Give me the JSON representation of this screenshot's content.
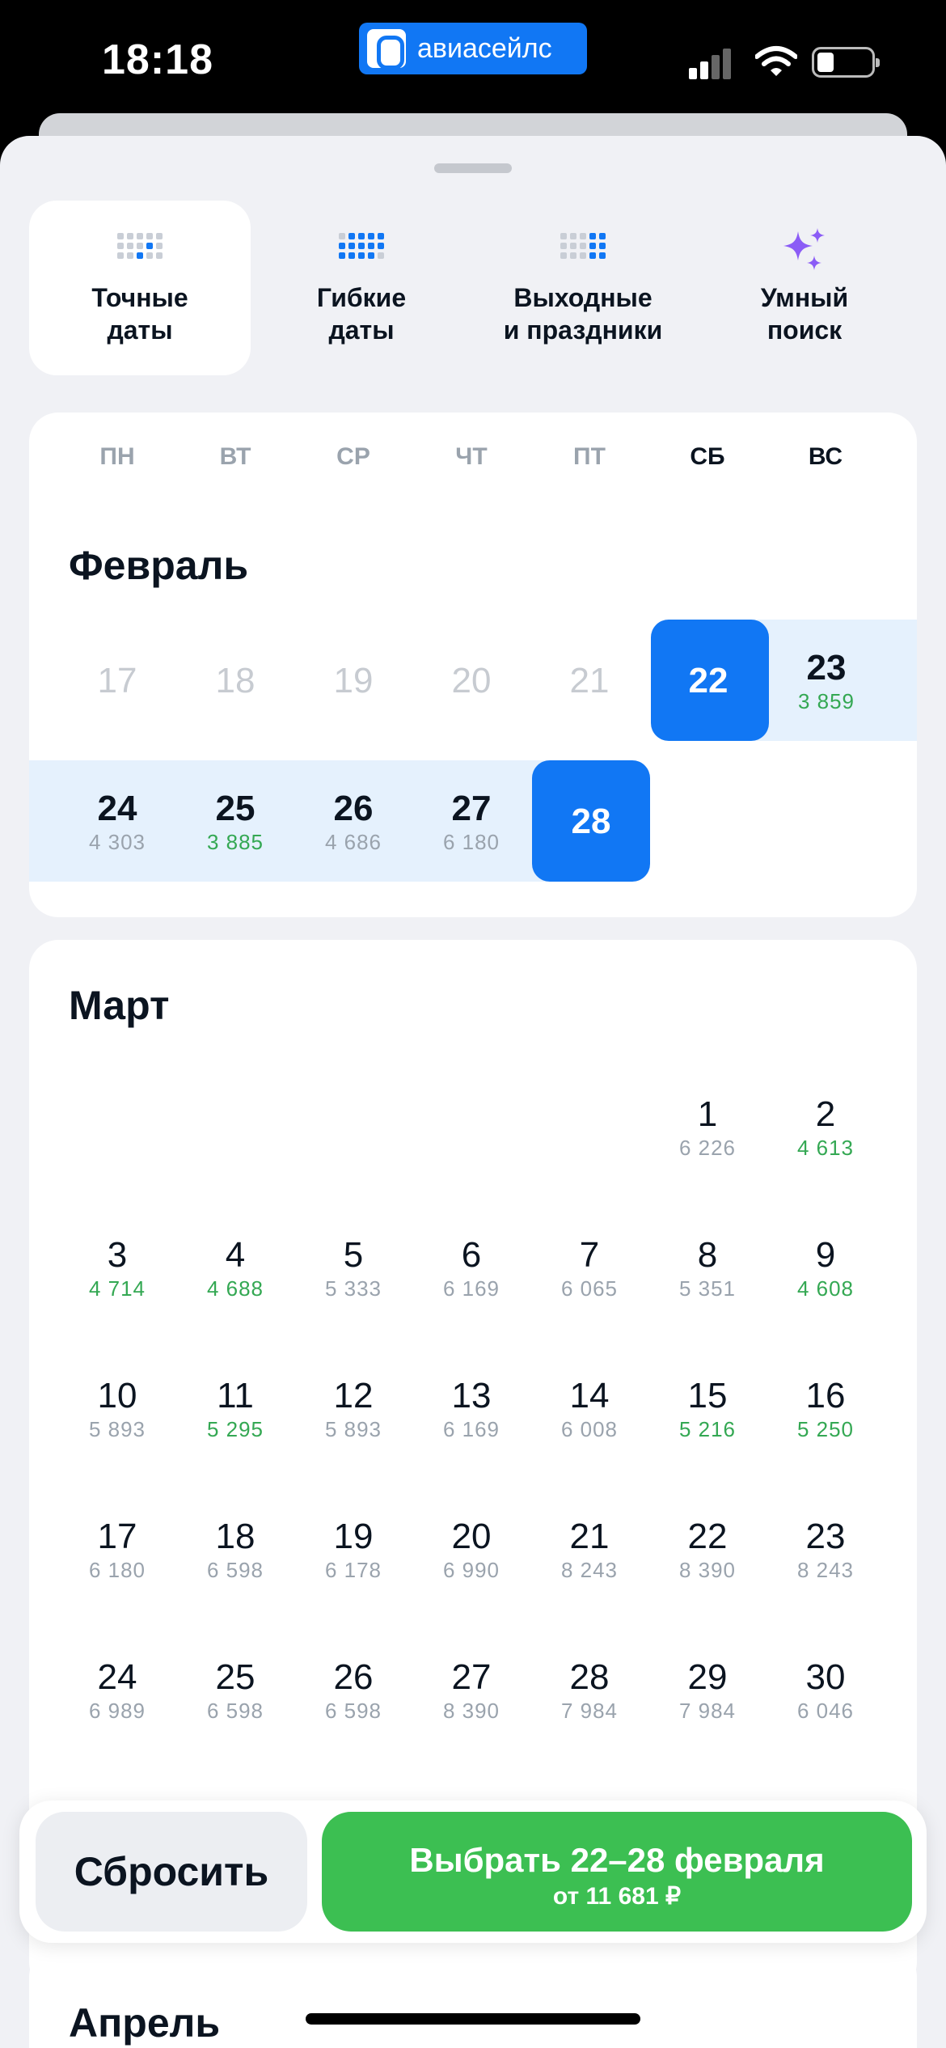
{
  "status_bar": {
    "time": "18:18",
    "app_name": "авиасейлс"
  },
  "mode_tabs": [
    {
      "label": "Точные\nдаты",
      "icon": "exact-dates-grid-icon",
      "active": true
    },
    {
      "label": "Гибкие\nдаты",
      "icon": "flexible-dates-grid-icon",
      "active": false
    },
    {
      "label": "Выходные\nи праздники",
      "icon": "weekends-grid-icon",
      "active": false
    },
    {
      "label": "Умный\nпоиск",
      "icon": "sparkles-icon",
      "active": false
    }
  ],
  "weekdays": [
    "ПН",
    "ВТ",
    "СР",
    "ЧТ",
    "ПТ",
    "СБ",
    "ВС"
  ],
  "february": {
    "title": "Февраль",
    "past_days": [
      "17",
      "18",
      "19",
      "20",
      "21"
    ],
    "selected_start": "22",
    "d23": {
      "day": "23",
      "price": "3 859"
    },
    "d24": {
      "day": "24",
      "price": "4 303"
    },
    "d25": {
      "day": "25",
      "price": "3 885"
    },
    "d26": {
      "day": "26",
      "price": "4 686"
    },
    "d27": {
      "day": "27",
      "price": "6 180"
    },
    "selected_end": "28"
  },
  "march": {
    "title": "Март",
    "days": [
      {
        "day": "1",
        "price": "6 226",
        "low": false
      },
      {
        "day": "2",
        "price": "4 613",
        "low": true
      },
      {
        "day": "3",
        "price": "4 714",
        "low": true
      },
      {
        "day": "4",
        "price": "4 688",
        "low": true
      },
      {
        "day": "5",
        "price": "5 333",
        "low": false
      },
      {
        "day": "6",
        "price": "6 169",
        "low": false
      },
      {
        "day": "7",
        "price": "6 065",
        "low": false
      },
      {
        "day": "8",
        "price": "5 351",
        "low": false
      },
      {
        "day": "9",
        "price": "4 608",
        "low": true
      },
      {
        "day": "10",
        "price": "5 893",
        "low": false
      },
      {
        "day": "11",
        "price": "5 295",
        "low": true
      },
      {
        "day": "12",
        "price": "5 893",
        "low": false
      },
      {
        "day": "13",
        "price": "6 169",
        "low": false
      },
      {
        "day": "14",
        "price": "6 008",
        "low": false
      },
      {
        "day": "15",
        "price": "5 216",
        "low": true
      },
      {
        "day": "16",
        "price": "5 250",
        "low": true
      },
      {
        "day": "17",
        "price": "6 180",
        "low": false
      },
      {
        "day": "18",
        "price": "6 598",
        "low": false
      },
      {
        "day": "19",
        "price": "6 178",
        "low": false
      },
      {
        "day": "20",
        "price": "6 990",
        "low": false
      },
      {
        "day": "21",
        "price": "8 243",
        "low": false
      },
      {
        "day": "22",
        "price": "8 390",
        "low": false
      },
      {
        "day": "23",
        "price": "8 243",
        "low": false
      },
      {
        "day": "24",
        "price": "6 989",
        "low": false
      },
      {
        "day": "25",
        "price": "6 598",
        "low": false
      },
      {
        "day": "26",
        "price": "6 598",
        "low": false
      },
      {
        "day": "27",
        "price": "8 390",
        "low": false
      },
      {
        "day": "28",
        "price": "7 984",
        "low": false
      },
      {
        "day": "29",
        "price": "7 984",
        "low": false
      },
      {
        "day": "30",
        "price": "6 046",
        "low": false
      }
    ]
  },
  "april": {
    "title": "Апрель"
  },
  "actions": {
    "reset_label": "Сбросить",
    "choose_label": "Выбрать 22–28 февраля",
    "choose_sub": "от 11 681 ₽"
  },
  "colors": {
    "accent_blue": "#1177f4",
    "low_price_green": "#34a853",
    "cta_green": "#3cbf52",
    "range_band": "#e5f1fd",
    "sparkle_purple": "#8b5cf6"
  }
}
